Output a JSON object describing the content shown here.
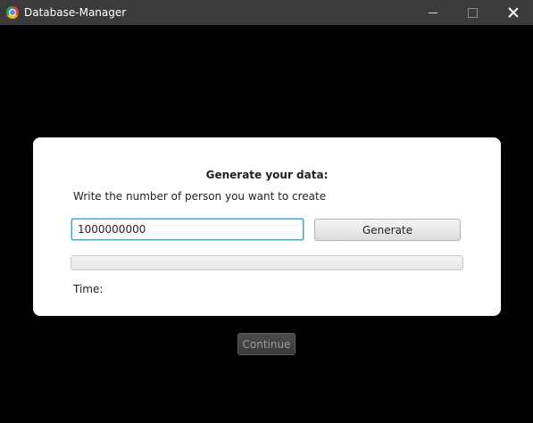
{
  "window": {
    "title": "Database-Manager",
    "icon": "database-manager-app-icon"
  },
  "generate_panel": {
    "heading": "Generate your data:",
    "instruction": "Write the number of person you want to create",
    "count_input_value": "1000000000",
    "generate_label": "Generate",
    "progress": 0,
    "time_label": "Time:"
  },
  "footer": {
    "continue_label": "Continue",
    "continue_enabled": false
  },
  "colors": {
    "background": "#000000",
    "titlebar": "#3b3b3b",
    "card": "#ffffff",
    "focus_accent": "#3ba7e6"
  }
}
